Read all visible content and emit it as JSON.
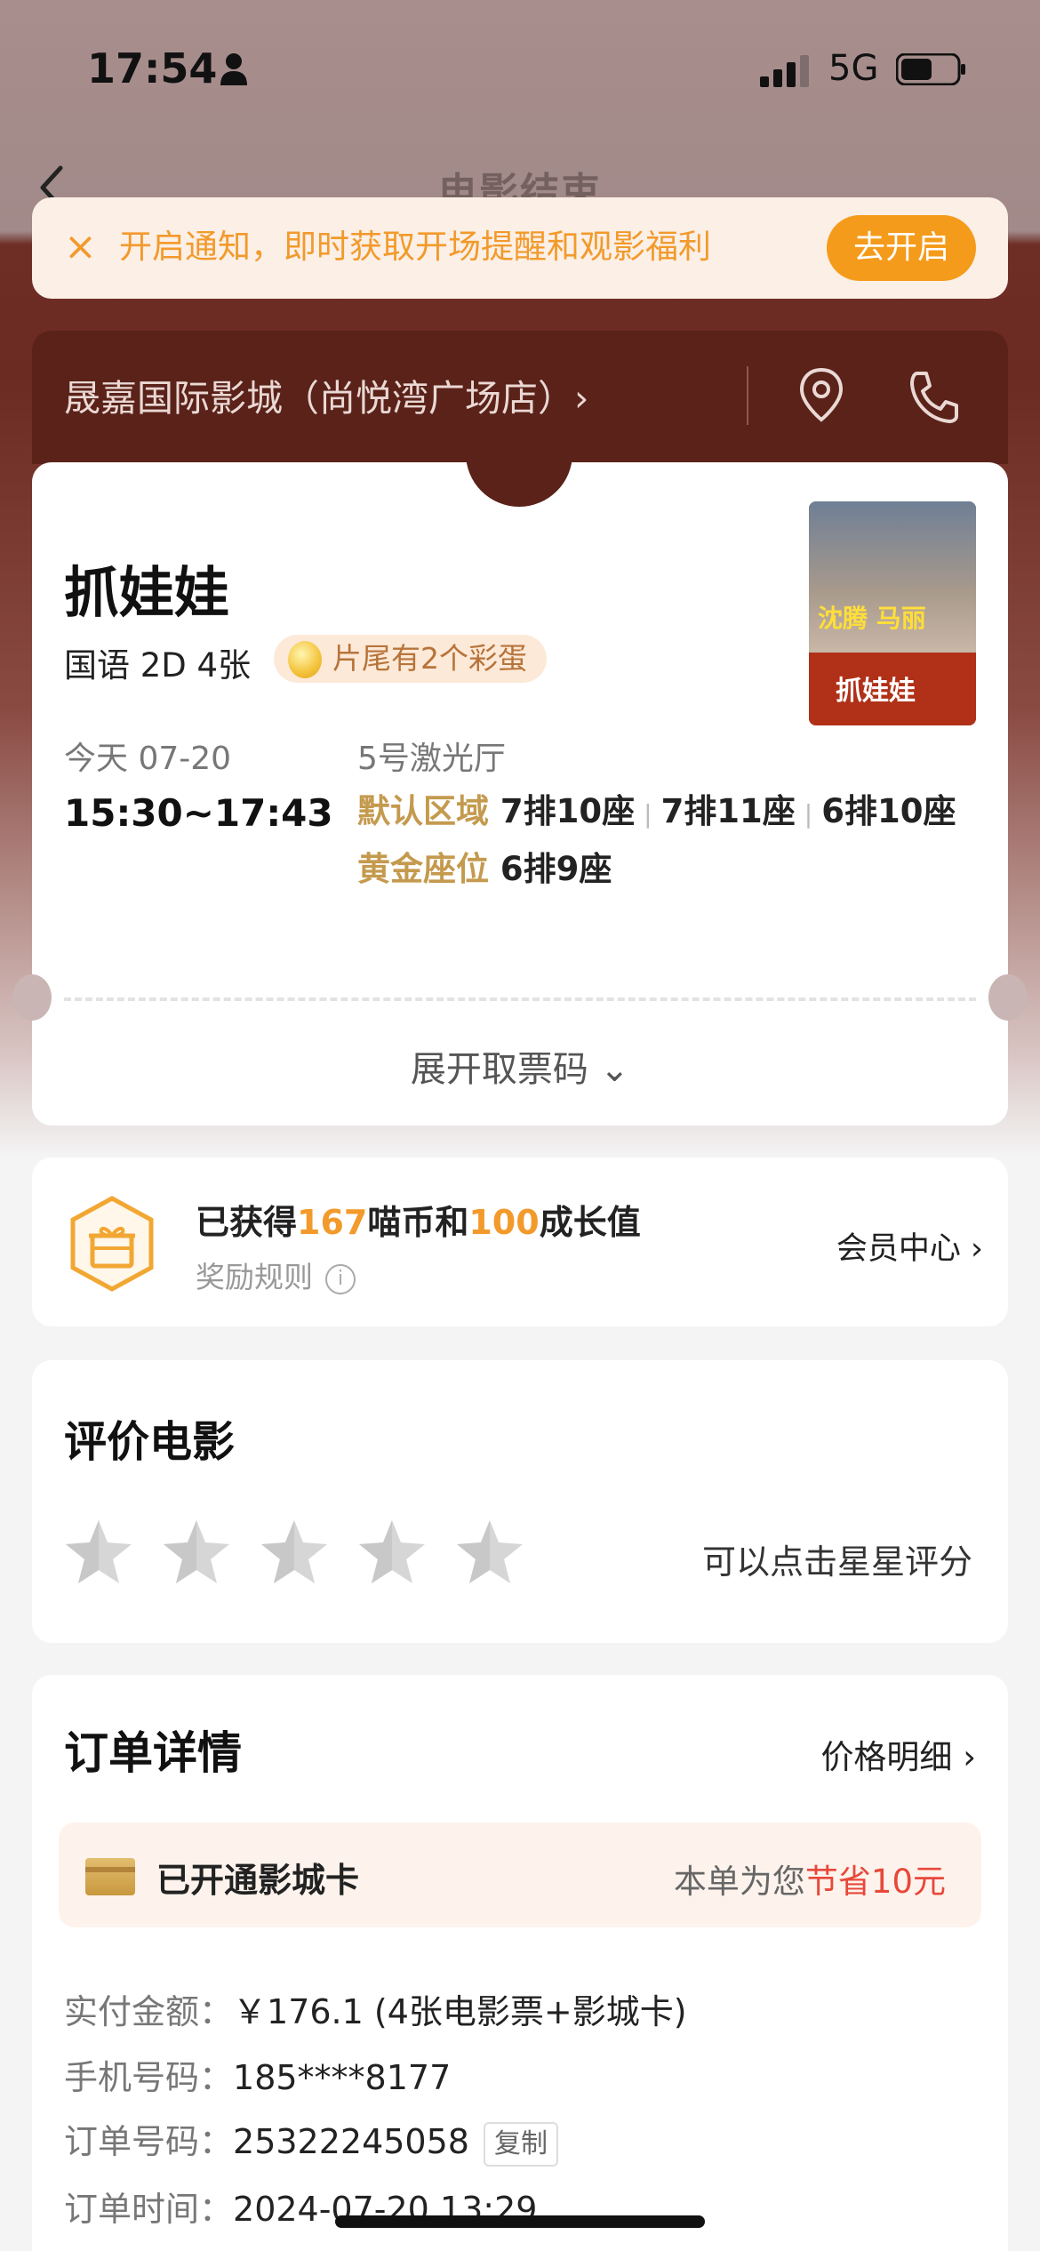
{
  "status_bar": {
    "time": "17:54",
    "network": "5G"
  },
  "nav": {
    "title": "电影结束"
  },
  "notice": {
    "close_icon": "×",
    "text": "开启通知，即时获取开场提醒和观影福利",
    "button": "去开启",
    "accent_color": "#f59b1b"
  },
  "cinema": {
    "name": "晟嘉国际影城（尚悦湾广场店）›"
  },
  "ticket": {
    "movie_title": "抓娃娃",
    "meta": "国语 2D 4张",
    "easter_egg": "片尾有2个彩蛋",
    "poster_text": {
      "line1": "沈腾 马丽",
      "line2": "抓娃娃"
    },
    "date": "今天 07-20",
    "time": "15:30~17:43",
    "hall": "5号激光厅",
    "zone1": "默认区域",
    "seat1": "7排10座",
    "seat2": "7排11座",
    "seat3": "6排10座",
    "zone2": "黄金座位",
    "seat4": "6排9座",
    "separator": "|",
    "expand_label": "展开取票码 ⌄"
  },
  "reward": {
    "prefix": "已获得",
    "coins": "167",
    "coins_label": "喵币和",
    "growth": "100",
    "growth_label": "成长值",
    "rules": "奖励规则",
    "member_center": "会员中心 ›"
  },
  "rating": {
    "heading": "评价电影",
    "stars": 5,
    "score": 0,
    "hint": "可以点击星星评分"
  },
  "order": {
    "heading": "订单详情",
    "price_detail": "价格明细 ›",
    "card_text": "已开通影城卡",
    "save_prefix": "本单为您",
    "save_amount": "节省10元",
    "paid_key": "实付金额：",
    "paid_value": "￥176.1 (4张电影票+影城卡)",
    "phone_key": "手机号码：",
    "phone_value": "185****8177",
    "order_key": "订单号码：",
    "order_value": "25322245058",
    "copy": "复制",
    "time_key": "订单时间：",
    "time_value": "2024-07-20 13:29"
  }
}
